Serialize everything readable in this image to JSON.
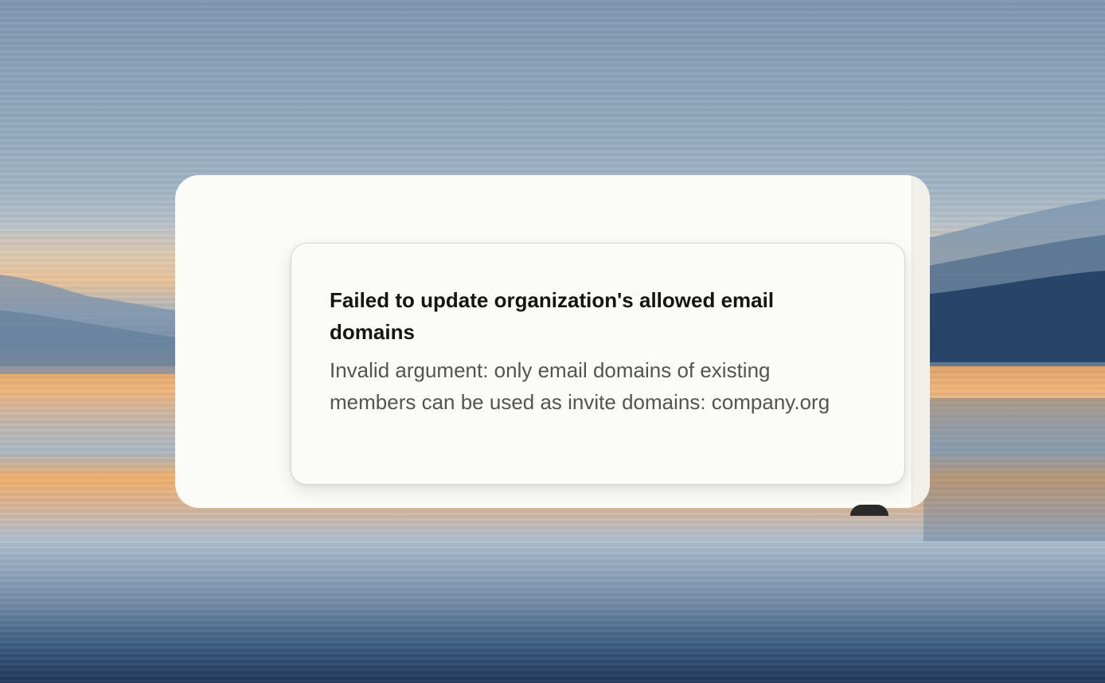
{
  "desktop": {
    "wallpaper": "landscape-lake-sunset"
  },
  "toast": {
    "title": "Failed to update organization's allowed email domains",
    "message": "Invalid argument: only email domains of existing members can be used as invite domains: company.org",
    "type": "error"
  },
  "colors": {
    "window_bg": "#fbfbf7",
    "toast_border": "#d6d5cf",
    "title_text": "#141413",
    "message_text": "#56544f"
  }
}
